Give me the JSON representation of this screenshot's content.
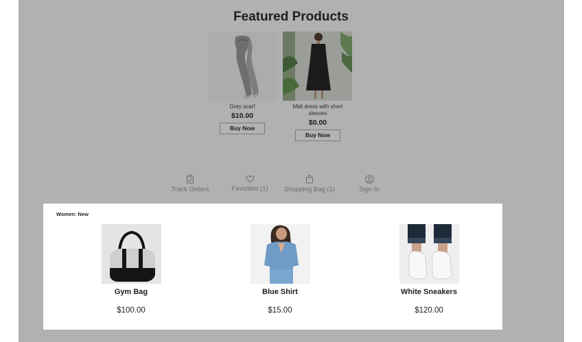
{
  "featured": {
    "title": "Featured Products",
    "products": [
      {
        "name": "Grey scarf",
        "price": "$10.00",
        "button": "Buy Now"
      },
      {
        "name": "Midi dress with short sleeves",
        "price": "$0.00",
        "button": "Buy Now"
      }
    ]
  },
  "nav": {
    "items": [
      {
        "label": "Track Orders",
        "icon": "track-orders-icon"
      },
      {
        "label": "Favorites (1)",
        "icon": "heart-icon"
      },
      {
        "label": "Shopping Bag (1)",
        "icon": "shopping-bag-icon"
      },
      {
        "label": "Sign In",
        "icon": "user-icon"
      }
    ]
  },
  "women_new": {
    "label": "Women: New",
    "items": [
      {
        "name": "Gym Bag",
        "price": "$100.00"
      },
      {
        "name": "Blue Shirt",
        "price": "$15.00"
      },
      {
        "name": "White Sneakers",
        "price": "$120.00"
      }
    ]
  },
  "colors": {
    "overlay": "#b1b1b1",
    "panel": "#ffffff",
    "nav_text": "#6a6a6a"
  }
}
